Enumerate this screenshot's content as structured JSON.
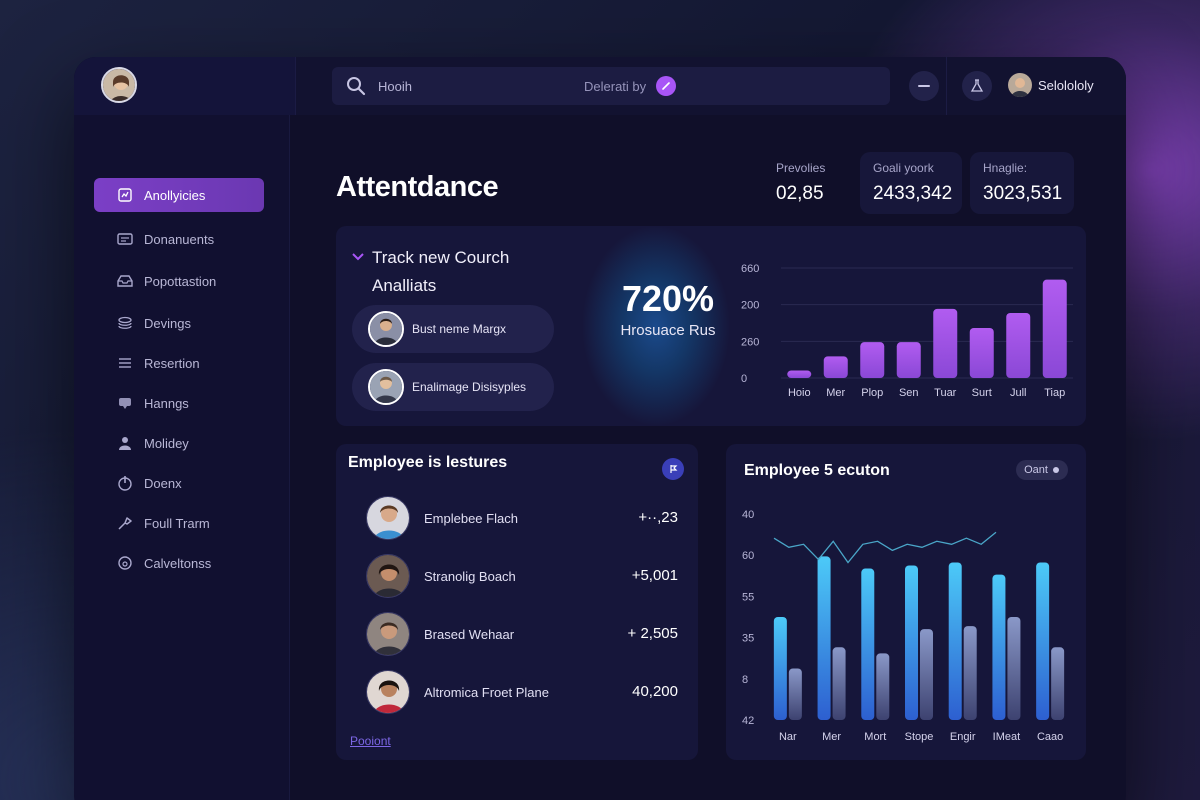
{
  "topbar": {
    "search_text": "Hooih",
    "search_mid": "Delerati by",
    "user_name": "Selolololy"
  },
  "sidebar": {
    "items": [
      {
        "label": "Anollyicies",
        "icon": "analytics-icon",
        "active": true
      },
      {
        "label": "Donanuents",
        "icon": "documents-icon",
        "active": false
      },
      {
        "label": "Popottastion",
        "icon": "inbox-icon",
        "active": false
      },
      {
        "label": "Devings",
        "icon": "layers-icon",
        "active": false
      },
      {
        "label": "Resertion",
        "icon": "list-icon",
        "active": false
      },
      {
        "label": "Hanngs",
        "icon": "chat-icon",
        "active": false
      },
      {
        "label": "Molidey",
        "icon": "user-icon",
        "active": false
      },
      {
        "label": "Doenx",
        "icon": "power-icon",
        "active": false
      },
      {
        "label": "Foull Trarm",
        "icon": "tool-icon",
        "active": false
      },
      {
        "label": "Calveltonss",
        "icon": "circle-icon",
        "active": false
      }
    ]
  },
  "header": {
    "title": "Attentdance",
    "stats": [
      {
        "label": "Prevolies",
        "value": "02,85"
      },
      {
        "label": "Goali yoork",
        "value": "2433,342"
      },
      {
        "label": "Hnaglie:",
        "value": "3023,531"
      }
    ]
  },
  "track": {
    "title_line1": "Track new Courch",
    "title_line2": "Analliats",
    "people": [
      {
        "name": "Bust neme Margx"
      },
      {
        "name": "Enalimage Disisyples"
      }
    ],
    "big_value": "720%",
    "big_label": "Hrosuace Rus"
  },
  "employees_card": {
    "title": "Employee is lestures",
    "rows": [
      {
        "name": "Emplebee Flach",
        "value": "+··,23"
      },
      {
        "name": "Stranolig Boach",
        "value": "+5,001"
      },
      {
        "name": "Brased Wehaar",
        "value": "+ 2,505"
      },
      {
        "name": "Altromica Froet Plane",
        "value": "40,200"
      }
    ],
    "link": "Pooiont"
  },
  "chart2_card": {
    "title": "Employee 5 ecuton",
    "filter_label": "Oant"
  },
  "colors": {
    "accent_purple": "#a855f7",
    "bar_purple": "#9a4fe0",
    "bar_blue": "#3fb4f2",
    "card_bg": "#16163a"
  },
  "chart_data": [
    {
      "type": "bar",
      "categories": [
        "Hoio",
        "Mer",
        "Plop",
        "Sen",
        "Tuar",
        "Surt",
        "Jull",
        "Tiap"
      ],
      "values": [
        45,
        130,
        215,
        215,
        415,
        300,
        390,
        590
      ],
      "y_ticks": [
        "660",
        "200",
        "260",
        "0"
      ],
      "ylim": [
        0,
        660
      ]
    },
    {
      "type": "bar",
      "categories": [
        "Nar",
        "Mer",
        "Mort",
        "Stope",
        "Engir",
        "IMeat",
        "Caao"
      ],
      "series": [
        {
          "values": [
            34,
            54,
            50,
            51,
            52,
            48,
            52
          ]
        },
        {
          "values": [
            17,
            24,
            22,
            30,
            31,
            34,
            24
          ]
        }
      ],
      "line_values": [
        60,
        57,
        58,
        53,
        59,
        52,
        58,
        59,
        56,
        58,
        57,
        59,
        58,
        60,
        58,
        62
      ],
      "y_ticks": [
        "40",
        "60",
        "55",
        "35",
        "8",
        "42"
      ],
      "ylim": [
        0,
        68
      ]
    }
  ]
}
